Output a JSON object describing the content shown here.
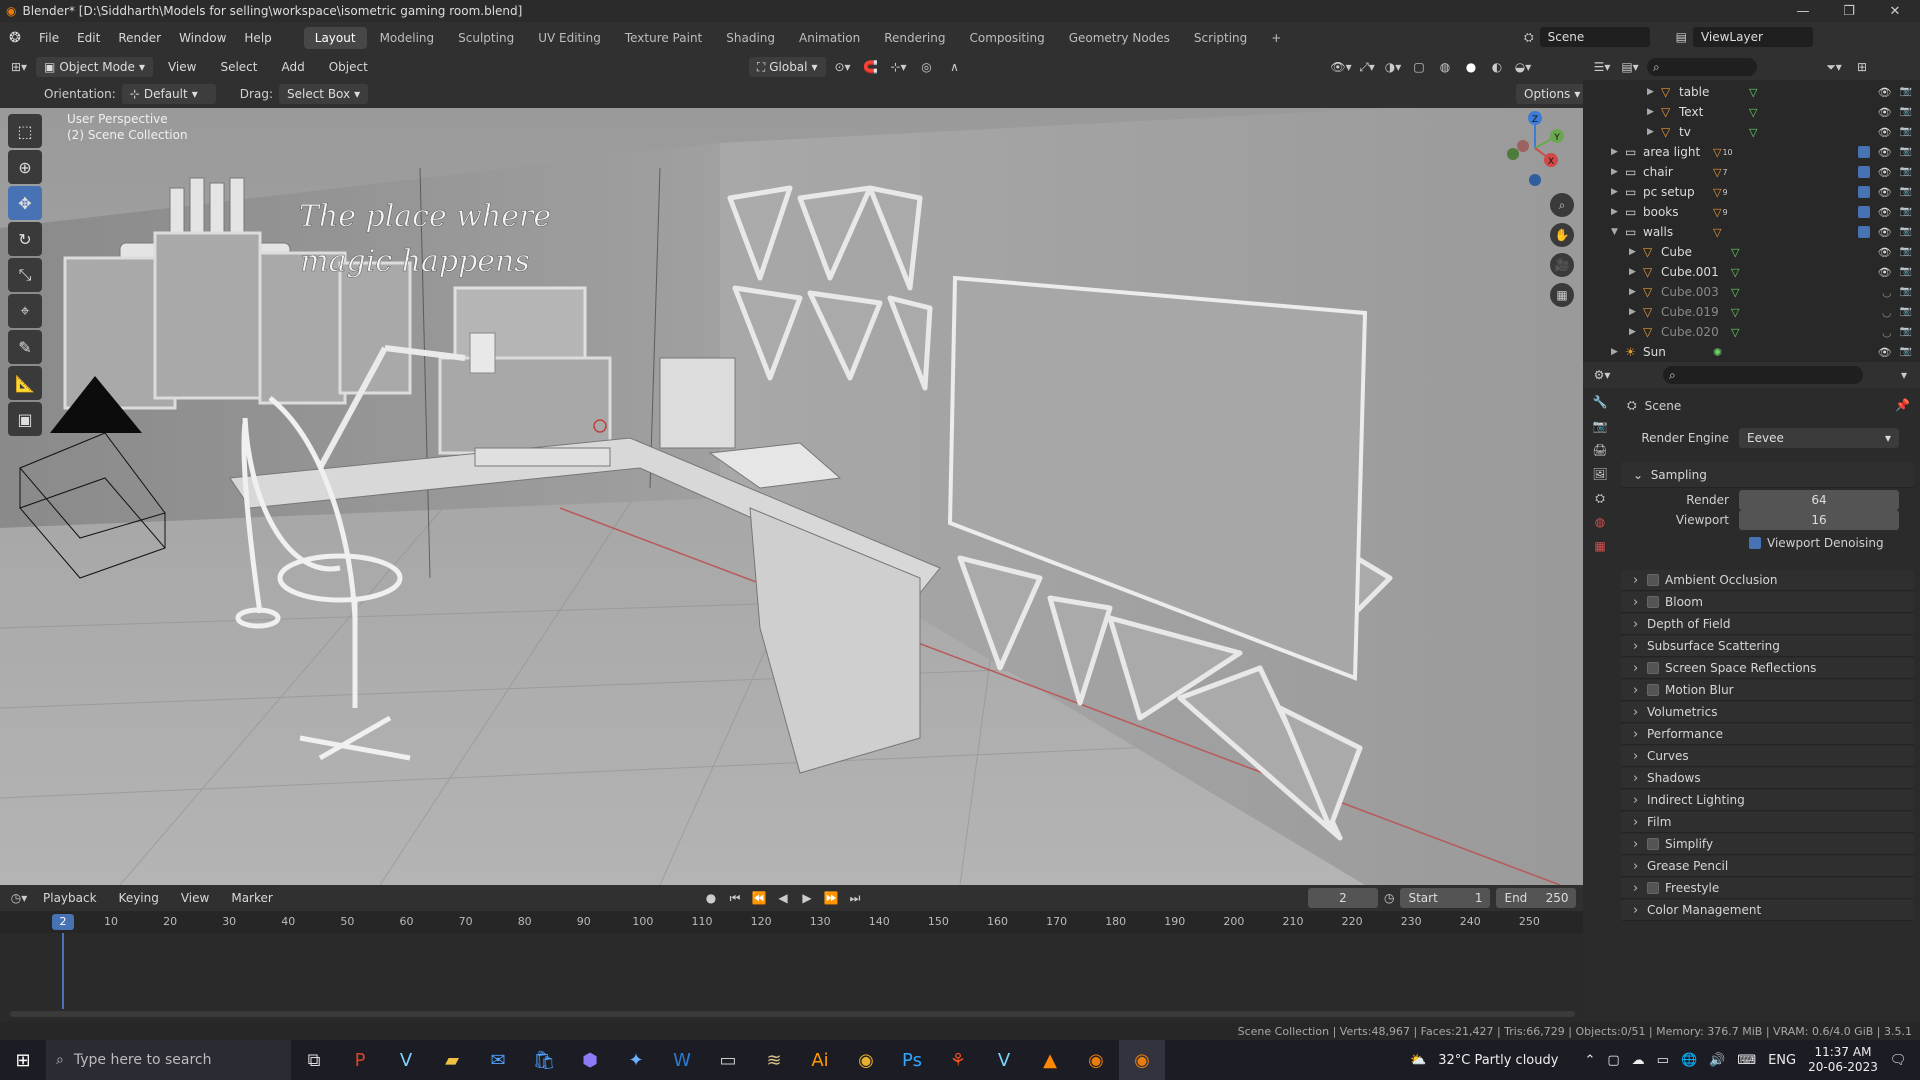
{
  "window": {
    "title": "Blender* [D:\\Siddharth\\Models for selling\\workspace\\isometric gaming room.blend]",
    "minimize": "—",
    "maximize": "❐",
    "close": "✕"
  },
  "menu": [
    "File",
    "Edit",
    "Render",
    "Window",
    "Help"
  ],
  "workspaces": [
    "Layout",
    "Modeling",
    "Sculpting",
    "UV Editing",
    "Texture Paint",
    "Shading",
    "Animation",
    "Rendering",
    "Compositing",
    "Geometry Nodes",
    "Scripting"
  ],
  "scene_name": "Scene",
  "view_layer": "ViewLayer",
  "viewport_header": {
    "mode": "Object Mode",
    "menus": [
      "View",
      "Select",
      "Add",
      "Object"
    ],
    "transform": "Global"
  },
  "tool_settings": {
    "orientation_label": "Orientation:",
    "orientation_value": "Default",
    "drag_label": "Drag:",
    "drag_value": "Select Box",
    "options": "Options"
  },
  "viewport": {
    "perspective": "User Perspective",
    "collection": "(2) Scene Collection",
    "neon_text_line1": "The place where",
    "neon_text_line2": "magic happens",
    "gizmo": {
      "x": "X",
      "y": "Y",
      "z": "Z"
    }
  },
  "outliner": {
    "rows": [
      {
        "name": "table",
        "indent": 3,
        "dim": false,
        "collection": false
      },
      {
        "name": "Text",
        "indent": 3,
        "dim": false,
        "collection": false
      },
      {
        "name": "tv",
        "indent": 3,
        "dim": false,
        "collection": false
      },
      {
        "name": "area light",
        "indent": 1,
        "dim": false,
        "collection": true,
        "badge": "10"
      },
      {
        "name": "chair",
        "indent": 1,
        "dim": false,
        "collection": true,
        "badge": "7"
      },
      {
        "name": "pc setup",
        "indent": 1,
        "dim": false,
        "collection": true,
        "badge": "9"
      },
      {
        "name": "books",
        "indent": 1,
        "dim": false,
        "collection": true,
        "badge": "9"
      },
      {
        "name": "walls",
        "indent": 1,
        "dim": false,
        "collection": true,
        "open": true
      },
      {
        "name": "Cube",
        "indent": 2,
        "dim": false,
        "collection": false
      },
      {
        "name": "Cube.001",
        "indent": 2,
        "dim": false,
        "collection": false
      },
      {
        "name": "Cube.003",
        "indent": 2,
        "dim": true,
        "collection": false
      },
      {
        "name": "Cube.019",
        "indent": 2,
        "dim": true,
        "collection": false
      },
      {
        "name": "Cube.020",
        "indent": 2,
        "dim": true,
        "collection": false
      },
      {
        "name": "Sun",
        "indent": 1,
        "dim": false,
        "collection": false,
        "sun": true
      }
    ]
  },
  "properties": {
    "context": "Scene",
    "render_engine_label": "Render Engine",
    "render_engine": "Eevee",
    "sampling": "Sampling",
    "render_label": "Render",
    "render_value": "64",
    "viewport_label": "Viewport",
    "viewport_value": "16",
    "denoise_label": "Viewport Denoising",
    "panels": [
      {
        "label": "Ambient Occlusion",
        "checkbox": true
      },
      {
        "label": "Bloom",
        "checkbox": true
      },
      {
        "label": "Depth of Field",
        "checkbox": false
      },
      {
        "label": "Subsurface Scattering",
        "checkbox": false
      },
      {
        "label": "Screen Space Reflections",
        "checkbox": true
      },
      {
        "label": "Motion Blur",
        "checkbox": true
      },
      {
        "label": "Volumetrics",
        "checkbox": false
      },
      {
        "label": "Performance",
        "checkbox": false
      },
      {
        "label": "Curves",
        "checkbox": false
      },
      {
        "label": "Shadows",
        "checkbox": false
      },
      {
        "label": "Indirect Lighting",
        "checkbox": false
      },
      {
        "label": "Film",
        "checkbox": false
      },
      {
        "label": "Simplify",
        "checkbox": true
      },
      {
        "label": "Grease Pencil",
        "checkbox": false
      },
      {
        "label": "Freestyle",
        "checkbox": true
      },
      {
        "label": "Color Management",
        "checkbox": false
      }
    ]
  },
  "timeline": {
    "menus": [
      "Playback",
      "Keying",
      "View",
      "Marker"
    ],
    "current_frame": "2",
    "start_label": "Start",
    "start": "1",
    "end_label": "End",
    "end": "250",
    "ticks": [
      "10",
      "20",
      "30",
      "40",
      "50",
      "60",
      "70",
      "80",
      "90",
      "100",
      "110",
      "120",
      "130",
      "140",
      "150",
      "160",
      "170",
      "180",
      "190",
      "200",
      "210",
      "220",
      "230",
      "240",
      "250"
    ]
  },
  "status": "Scene Collection | Verts:48,967 | Faces:21,427 | Tris:66,729 | Objects:0/51 | Memory: 376.7 MiB | VRAM: 0.6/4.0 GiB | 3.5.1",
  "taskbar": {
    "search_placeholder": "Type here to search",
    "weather": "32°C  Partly cloudy",
    "lang": "ENG",
    "time": "11:37 AM",
    "date": "20-06-2023"
  }
}
